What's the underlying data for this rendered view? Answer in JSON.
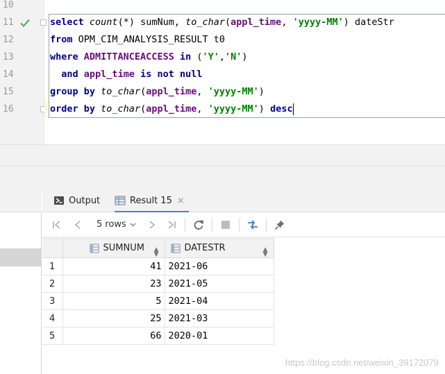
{
  "editor": {
    "line_numbers": [
      "10",
      "11",
      "12",
      "13",
      "14",
      "15",
      "16"
    ],
    "lines": [
      "select count(*) sumNum, to_char(appl_time, 'yyyy-MM') dateStr",
      "from OPM_CIM_ANALYSIS_RESULT t0",
      "where ADMITTANCEACCESS in ('Y','N')",
      "  and appl_time is not null",
      "group by to_char(appl_time, 'yyyy-MM')",
      "order by to_char(appl_time, 'yyyy-MM') desc"
    ],
    "colors": {
      "keyword": "#000080",
      "string": "#008000",
      "column": "#660e7a",
      "current_line": "#fcfadf"
    }
  },
  "tabs": [
    {
      "label": "Output",
      "icon": "console-icon"
    },
    {
      "label": "Result 15",
      "icon": "table-icon",
      "close": "×",
      "active": true
    }
  ],
  "toolbar": {
    "rows_label": "5 rows",
    "buttons": [
      "first-page-icon",
      "prev-page-icon",
      "next-page-icon",
      "last-page-icon",
      "refresh-icon",
      "stop-icon",
      "compare-icon",
      "pin-icon"
    ]
  },
  "grid": {
    "columns": [
      "SUMNUM",
      "DATESTR"
    ],
    "rows": [
      {
        "n": "1",
        "sumnum": "41",
        "datestr": "2021-06"
      },
      {
        "n": "2",
        "sumnum": "23",
        "datestr": "2021-05"
      },
      {
        "n": "3",
        "sumnum": "5",
        "datestr": "2021-04"
      },
      {
        "n": "4",
        "sumnum": "25",
        "datestr": "2021-03"
      },
      {
        "n": "5",
        "sumnum": "66",
        "datestr": "2020-01"
      }
    ]
  },
  "watermark": "https://blog.csdn.net/weixin_39172079"
}
